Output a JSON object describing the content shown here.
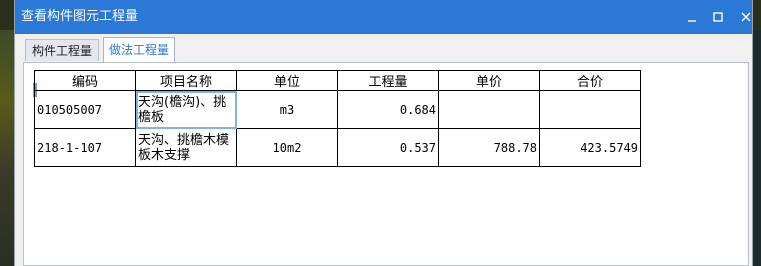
{
  "window": {
    "title": "查看构件图元工程量"
  },
  "tabs": [
    {
      "label": "构件工程量",
      "active": false
    },
    {
      "label": "做法工程量",
      "active": true
    }
  ],
  "table": {
    "headers": [
      "编码",
      "项目名称",
      "单位",
      "工程量",
      "单价",
      "合价"
    ],
    "rows": [
      {
        "code": "010505007",
        "name": "天沟(檐沟)、挑檐板",
        "unit": "m3",
        "qty": "0.684",
        "price": "",
        "total": ""
      },
      {
        "code": "218-1-107",
        "name": "天沟、挑檐木模板木支撑",
        "unit": "10m2",
        "qty": "0.537",
        "price": "788.78",
        "total": "423.5749"
      }
    ]
  },
  "colors": {
    "titlebar": "#2b78d6",
    "active_tab_text": "#2b78d6"
  }
}
